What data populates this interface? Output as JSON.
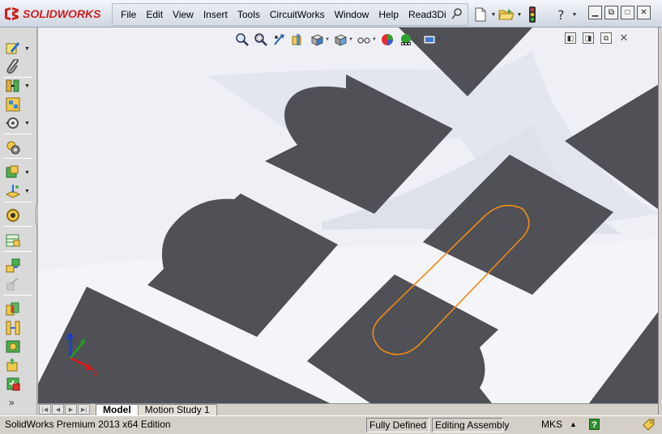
{
  "app": {
    "brand": "SOLIDWORKS"
  },
  "menu": [
    "File",
    "Edit",
    "View",
    "Insert",
    "Tools",
    "CircuitWorks",
    "Window",
    "Help",
    "Read3Di"
  ],
  "quick_tools": [
    {
      "icon": "new-document-icon",
      "has_dropdown": true
    },
    {
      "icon": "open-folder-icon",
      "has_dropdown": true
    },
    {
      "icon": "rebuild-traffic-light-icon",
      "has_dropdown": false
    },
    {
      "icon": "help-question-icon",
      "has_dropdown": true
    }
  ],
  "window_controls": [
    "minimize-icon",
    "restore-icon",
    "maximize-icon",
    "close-icon"
  ],
  "left_toolbar": [
    {
      "icon": "sketch-icon",
      "has_dropdown": true
    },
    {
      "icon": "paperclip-icon",
      "has_dropdown": false
    },
    {
      "icon": "mate-icon",
      "has_dropdown": true
    },
    {
      "icon": "component-pattern-icon",
      "has_dropdown": false
    },
    {
      "icon": "move-component-icon",
      "has_dropdown": true
    },
    {
      "icon": "smart-fasteners-icon",
      "has_dropdown": false
    },
    {
      "icon": "assembly-features-icon",
      "has_dropdown": true
    },
    {
      "icon": "reference-geometry-icon",
      "has_dropdown": true
    },
    {
      "icon": "new-motion-study-icon",
      "has_dropdown": false
    },
    {
      "icon": "bill-of-materials-icon",
      "has_dropdown": false
    },
    {
      "icon": "exploded-view-icon",
      "has_dropdown": false
    },
    {
      "icon": "explode-line-sketch-icon",
      "has_dropdown": false
    },
    {
      "icon": "interference-detection-icon",
      "has_dropdown": false
    },
    {
      "icon": "clearance-verification-icon",
      "has_dropdown": false
    },
    {
      "icon": "hole-alignment-icon",
      "has_dropdown": false
    },
    {
      "icon": "instant3d-icon",
      "has_dropdown": false
    },
    {
      "icon": "assembly-xpert-icon",
      "has_dropdown": false
    },
    {
      "icon": "more-chevron-icon",
      "has_dropdown": false
    }
  ],
  "headsup_toolbar": [
    "zoom-to-fit-icon",
    "zoom-to-area-icon",
    "previous-view-icon",
    "section-view-icon",
    "view-orientation-icon",
    "display-style-icon",
    "hide-show-items-icon",
    "edit-appearance-icon",
    "apply-scene-icon",
    "view-settings-icon"
  ],
  "tabs": [
    {
      "label": "Model",
      "active": true
    },
    {
      "label": "Motion Study 1",
      "active": false
    }
  ],
  "status": {
    "edition": "SolidWorks Premium 2013 x64 Edition",
    "definition": "Fully Defined",
    "mode": "Editing Assembly",
    "units": "MKS",
    "units_arrow": "▲"
  },
  "triad_axes": [
    "Z",
    "X"
  ],
  "colors": {
    "part_face": "#505057",
    "background": "#eef0f5",
    "highlight": "#f08a14",
    "brand_red": "#cc1f1f"
  }
}
